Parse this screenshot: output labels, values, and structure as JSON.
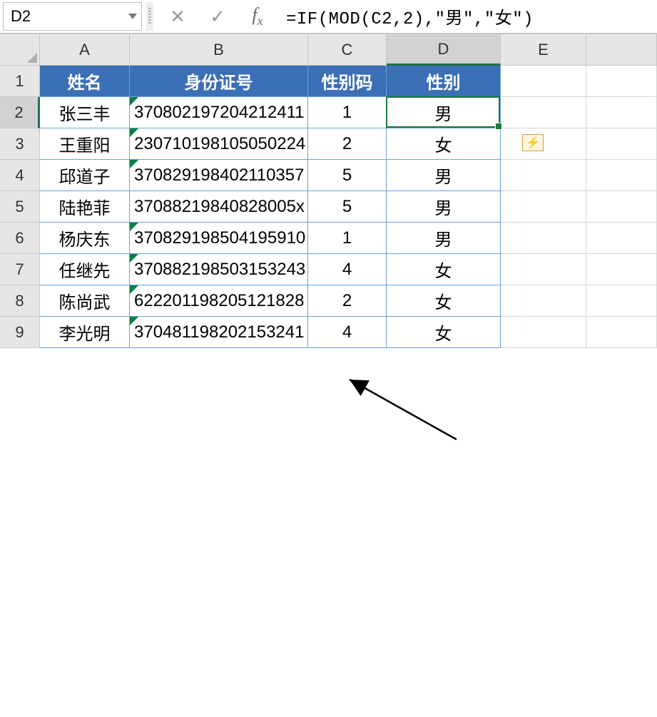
{
  "name_box": {
    "value": "D2"
  },
  "formula_bar": {
    "cancel_glyph": "✕",
    "enter_glyph": "✓",
    "fx_label": "fx",
    "formula": "=IF(MOD(C2,2),\"男\",\"女\")"
  },
  "columns": [
    "A",
    "B",
    "C",
    "D",
    "E"
  ],
  "row_numbers": [
    "1",
    "2",
    "3",
    "4",
    "5",
    "6",
    "7",
    "8",
    "9"
  ],
  "selected_col_index": 3,
  "selected_row_index": 1,
  "header": {
    "A": "姓名",
    "B": "身份证号",
    "C": "性别码",
    "D": "性别"
  },
  "rows": [
    {
      "A": "张三丰",
      "B": "370802197204212411",
      "C": "1",
      "D": "男"
    },
    {
      "A": "王重阳",
      "B": "230710198105050224",
      "C": "2",
      "D": "女"
    },
    {
      "A": "邱道子",
      "B": "370829198402110357",
      "C": "5",
      "D": "男"
    },
    {
      "A": "陆艳菲",
      "B": "37088219840828005x",
      "C": "5",
      "D": "男"
    },
    {
      "A": "杨庆东",
      "B": "370829198504195910",
      "C": "1",
      "D": "男"
    },
    {
      "A": "任继先",
      "B": "370882198503153243",
      "C": "4",
      "D": "女"
    },
    {
      "A": "陈尚武",
      "B": "622201198205121828",
      "C": "2",
      "D": "女"
    },
    {
      "A": "李光明",
      "B": "370481198202153241",
      "C": "4",
      "D": "女"
    }
  ],
  "smart_tag": {
    "glyph": "⚡"
  },
  "chart_data": {
    "type": "table",
    "title": "",
    "columns": [
      "姓名",
      "身份证号",
      "性别码",
      "性别"
    ],
    "data": [
      [
        "张三丰",
        "370802197204212411",
        1,
        "男"
      ],
      [
        "王重阳",
        "230710198105050224",
        2,
        "女"
      ],
      [
        "邱道子",
        "370829198402110357",
        5,
        "男"
      ],
      [
        "陆艳菲",
        "37088219840828005x",
        5,
        "男"
      ],
      [
        "杨庆东",
        "370829198504195910",
        1,
        "男"
      ],
      [
        "任继先",
        "370882198503153243",
        4,
        "女"
      ],
      [
        "陈尚武",
        "622201198205121828",
        2,
        "女"
      ],
      [
        "李光明",
        "370481198202153241",
        4,
        "女"
      ]
    ]
  }
}
